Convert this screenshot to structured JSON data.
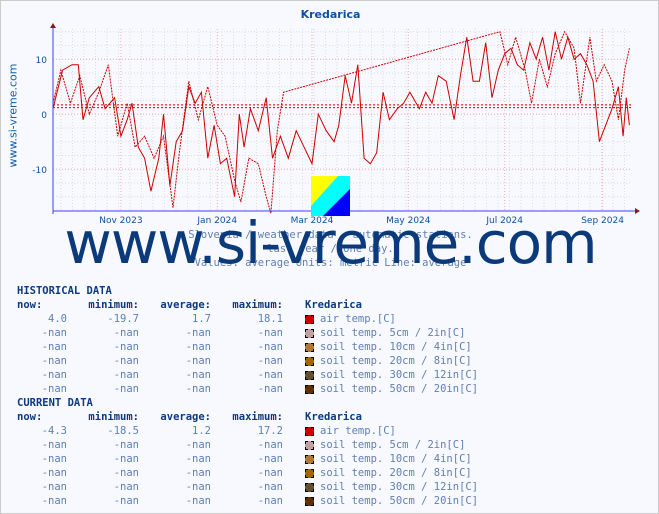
{
  "title": "Kredarica",
  "side_watermark": "www.si-vreme.com",
  "watermark": "www.si-vreme.com",
  "caption": [
    "Slovenia / weather data - automatic stations.",
    "last year / one day.",
    "Values: average  Units: metric  Line: average"
  ],
  "chart_data": {
    "type": "line",
    "title": "Kredarica",
    "xlim": [
      "2023-09-19",
      "2024-09-19"
    ],
    "ylim": [
      -17.6,
      15.5
    ],
    "yticks": [
      -10,
      0,
      10
    ],
    "xticks": [
      {
        "date": "2023-11-01",
        "label": "Nov 2023"
      },
      {
        "date": "2024-01-01",
        "label": "Jan 2024"
      },
      {
        "date": "2024-03-01",
        "label": "Mar 2024"
      },
      {
        "date": "2024-05-01",
        "label": "May 2024"
      },
      {
        "date": "2024-07-01",
        "label": "Jul 2024"
      },
      {
        "date": "2024-09-01",
        "label": "Sep 2024"
      }
    ],
    "grid": true,
    "color": "#cc0000",
    "average_lines": [
      1.2,
      1.7
    ],
    "series": [
      {
        "style": "solid",
        "points": [
          [
            "2023-09-19",
            1
          ],
          [
            "2023-09-25",
            8
          ],
          [
            "2023-10-01",
            9
          ],
          [
            "2023-10-05",
            9
          ],
          [
            "2023-10-08",
            -1
          ],
          [
            "2023-10-12",
            3
          ],
          [
            "2023-10-18",
            5
          ],
          [
            "2023-10-22",
            1
          ],
          [
            "2023-10-28",
            3
          ],
          [
            "2023-11-01",
            -4
          ],
          [
            "2023-11-05",
            -1
          ],
          [
            "2023-11-08",
            2
          ],
          [
            "2023-11-12",
            -6
          ],
          [
            "2023-11-16",
            -8
          ],
          [
            "2023-11-20",
            -14
          ],
          [
            "2023-11-25",
            -8
          ],
          [
            "2023-11-28",
            0
          ],
          [
            "2023-12-02",
            -13
          ],
          [
            "2023-12-06",
            -5
          ],
          [
            "2023-12-10",
            -3
          ],
          [
            "2023-12-14",
            5
          ],
          [
            "2023-12-18",
            2
          ],
          [
            "2023-12-22",
            4
          ],
          [
            "2023-12-26",
            -8
          ],
          [
            "2023-12-30",
            -2
          ],
          [
            "2024-01-03",
            -9
          ],
          [
            "2024-01-07",
            -8
          ],
          [
            "2024-01-12",
            -15
          ],
          [
            "2024-01-15",
            0
          ],
          [
            "2024-01-18",
            -6
          ],
          [
            "2024-01-22",
            1
          ],
          [
            "2024-01-27",
            -3
          ],
          [
            "2024-02-01",
            3
          ],
          [
            "2024-02-05",
            -8
          ],
          [
            "2024-02-10",
            -4
          ],
          [
            "2024-02-15",
            -8
          ],
          [
            "2024-02-20",
            -3
          ],
          [
            "2024-02-25",
            -6
          ],
          [
            "2024-03-01",
            -9
          ],
          [
            "2024-03-05",
            0
          ],
          [
            "2024-03-10",
            -3
          ],
          [
            "2024-03-15",
            -5
          ],
          [
            "2024-03-18",
            -2
          ],
          [
            "2024-03-22",
            7
          ],
          [
            "2024-03-26",
            2
          ],
          [
            "2024-03-30",
            9
          ],
          [
            "2024-04-03",
            -8
          ],
          [
            "2024-04-07",
            -9
          ],
          [
            "2024-04-11",
            -7
          ],
          [
            "2024-04-15",
            4
          ],
          [
            "2024-04-19",
            -1
          ],
          [
            "2024-04-24",
            1
          ],
          [
            "2024-04-28",
            2
          ],
          [
            "2024-05-02",
            4
          ],
          [
            "2024-05-08",
            1
          ],
          [
            "2024-05-12",
            4
          ],
          [
            "2024-05-16",
            2
          ],
          [
            "2024-05-20",
            7
          ],
          [
            "2024-05-25",
            6
          ],
          [
            "2024-05-30",
            -1
          ],
          [
            "2024-06-03",
            7
          ],
          [
            "2024-06-07",
            14
          ],
          [
            "2024-06-11",
            6
          ],
          [
            "2024-06-15",
            6
          ],
          [
            "2024-06-19",
            13
          ],
          [
            "2024-06-23",
            3
          ],
          [
            "2024-06-27",
            8
          ],
          [
            "2024-07-01",
            11
          ],
          [
            "2024-07-05",
            12
          ],
          [
            "2024-07-09",
            9
          ],
          [
            "2024-07-13",
            8
          ],
          [
            "2024-07-17",
            13
          ],
          [
            "2024-07-21",
            10
          ],
          [
            "2024-07-25",
            14
          ],
          [
            "2024-07-29",
            8
          ],
          [
            "2024-08-02",
            15
          ],
          [
            "2024-08-06",
            10
          ],
          [
            "2024-08-10",
            14
          ],
          [
            "2024-08-14",
            10
          ],
          [
            "2024-08-18",
            11
          ],
          [
            "2024-08-22",
            9
          ],
          [
            "2024-08-26",
            6
          ],
          [
            "2024-08-30",
            -5
          ],
          [
            "2024-09-03",
            -2
          ],
          [
            "2024-09-07",
            1
          ],
          [
            "2024-09-11",
            5
          ],
          [
            "2024-09-14",
            -4
          ],
          [
            "2024-09-16",
            3
          ],
          [
            "2024-09-18",
            -2
          ]
        ]
      },
      {
        "style": "dashed",
        "points": [
          [
            "2023-09-19",
            2
          ],
          [
            "2023-09-24",
            8
          ],
          [
            "2023-09-30",
            2
          ],
          [
            "2023-10-06",
            7
          ],
          [
            "2023-10-12",
            0
          ],
          [
            "2023-10-18",
            4
          ],
          [
            "2023-10-24",
            9
          ],
          [
            "2023-10-30",
            -4
          ],
          [
            "2023-11-05",
            2
          ],
          [
            "2023-11-10",
            -6
          ],
          [
            "2023-11-16",
            -4
          ],
          [
            "2023-11-22",
            -8
          ],
          [
            "2023-11-28",
            -4
          ],
          [
            "2023-12-04",
            -17
          ],
          [
            "2023-12-08",
            -7
          ],
          [
            "2023-12-14",
            6
          ],
          [
            "2023-12-20",
            -1
          ],
          [
            "2023-12-26",
            5
          ],
          [
            "2024-01-01",
            -2
          ],
          [
            "2024-01-06",
            -4
          ],
          [
            "2024-01-12",
            -12
          ],
          [
            "2024-01-16",
            -16
          ],
          [
            "2024-01-21",
            -8
          ],
          [
            "2024-01-27",
            -9
          ],
          [
            "2024-02-01",
            -15
          ],
          [
            "2024-02-04",
            -18
          ],
          [
            "2024-02-08",
            -3
          ],
          [
            "2024-02-12",
            4
          ],
          [
            "2024-06-28",
            15
          ],
          [
            "2024-07-03",
            9
          ],
          [
            "2024-07-08",
            14
          ],
          [
            "2024-07-14",
            8
          ],
          [
            "2024-07-18",
            2
          ],
          [
            "2024-07-23",
            10
          ],
          [
            "2024-07-28",
            5
          ],
          [
            "2024-08-02",
            11
          ],
          [
            "2024-08-08",
            15
          ],
          [
            "2024-08-14",
            12
          ],
          [
            "2024-08-18",
            2
          ],
          [
            "2024-08-24",
            14
          ],
          [
            "2024-08-28",
            6
          ],
          [
            "2024-09-02",
            9
          ],
          [
            "2024-09-07",
            6
          ],
          [
            "2024-09-11",
            -1
          ],
          [
            "2024-09-15",
            8
          ],
          [
            "2024-09-18",
            12
          ]
        ]
      }
    ]
  },
  "historical": {
    "heading": "HISTORICAL DATA",
    "headers": [
      "now:",
      "minimum:",
      "average:",
      "maximum:",
      "Kredarica"
    ],
    "rows": [
      {
        "now": "4.0",
        "min": "-19.7",
        "avg": "1.7",
        "max": "18.1",
        "label": "air temp.[C]",
        "color": "#cc0000"
      },
      {
        "now": "-nan",
        "min": "-nan",
        "avg": "-nan",
        "max": "-nan",
        "label": "soil temp. 5cm / 2in[C]",
        "color": "#c0a0a0"
      },
      {
        "now": "-nan",
        "min": "-nan",
        "avg": "-nan",
        "max": "-nan",
        "label": "soil temp. 10cm / 4in[C]",
        "color": "#b07838"
      },
      {
        "now": "-nan",
        "min": "-nan",
        "avg": "-nan",
        "max": "-nan",
        "label": "soil temp. 20cm / 8in[C]",
        "color": "#a06800"
      },
      {
        "now": "-nan",
        "min": "-nan",
        "avg": "-nan",
        "max": "-nan",
        "label": "soil temp. 30cm / 12in[C]",
        "color": "#605030"
      },
      {
        "now": "-nan",
        "min": "-nan",
        "avg": "-nan",
        "max": "-nan",
        "label": "soil temp. 50cm / 20in[C]",
        "color": "#603000"
      }
    ]
  },
  "current": {
    "heading": "CURRENT DATA",
    "headers": [
      "now:",
      "minimum:",
      "average:",
      "maximum:",
      "Kredarica"
    ],
    "rows": [
      {
        "now": "-4.3",
        "min": "-18.5",
        "avg": "1.2",
        "max": "17.2",
        "label": "air temp.[C]",
        "color": "#cc0000"
      },
      {
        "now": "-nan",
        "min": "-nan",
        "avg": "-nan",
        "max": "-nan",
        "label": "soil temp. 5cm / 2in[C]",
        "color": "#c0a0a0"
      },
      {
        "now": "-nan",
        "min": "-nan",
        "avg": "-nan",
        "max": "-nan",
        "label": "soil temp. 10cm / 4in[C]",
        "color": "#b07838"
      },
      {
        "now": "-nan",
        "min": "-nan",
        "avg": "-nan",
        "max": "-nan",
        "label": "soil temp. 20cm / 8in[C]",
        "color": "#a06800"
      },
      {
        "now": "-nan",
        "min": "-nan",
        "avg": "-nan",
        "max": "-nan",
        "label": "soil temp. 30cm / 12in[C]",
        "color": "#605030"
      },
      {
        "now": "-nan",
        "min": "-nan",
        "avg": "-nan",
        "max": "-nan",
        "label": "soil temp. 50cm / 20in[C]",
        "color": "#603000"
      }
    ]
  }
}
